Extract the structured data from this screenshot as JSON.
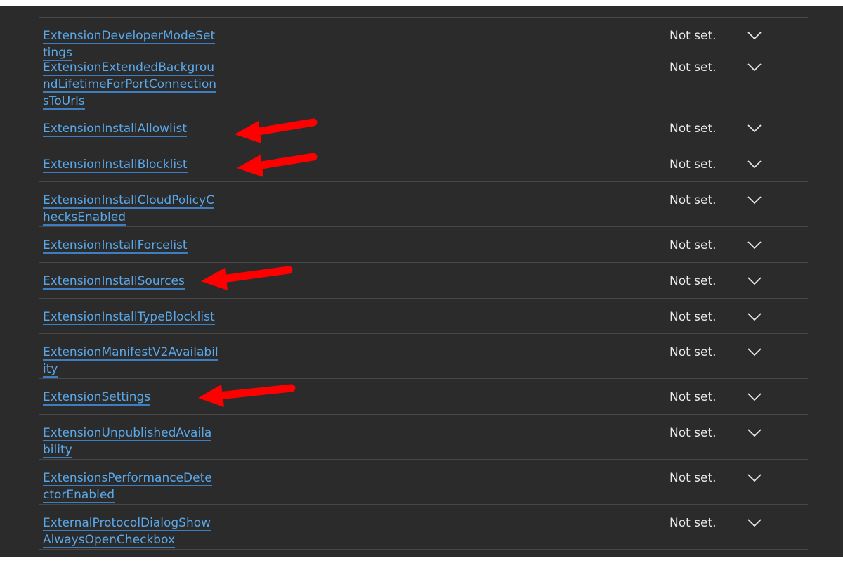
{
  "policies": [
    {
      "name": "ExtensionDeveloperModeSettings",
      "status": "Not set."
    },
    {
      "name": "ExtensionExtendedBackgroundLifetimeForPortConnectionsToUrls",
      "status": "Not set."
    },
    {
      "name": "ExtensionInstallAllowlist",
      "status": "Not set."
    },
    {
      "name": "ExtensionInstallBlocklist",
      "status": "Not set."
    },
    {
      "name": "ExtensionInstallCloudPolicyChecksEnabled",
      "status": "Not set."
    },
    {
      "name": "ExtensionInstallForcelist",
      "status": "Not set."
    },
    {
      "name": "ExtensionInstallSources",
      "status": "Not set."
    },
    {
      "name": "ExtensionInstallTypeBlocklist",
      "status": "Not set."
    },
    {
      "name": "ExtensionManifestV2Availability",
      "status": "Not set."
    },
    {
      "name": "ExtensionSettings",
      "status": "Not set."
    },
    {
      "name": "ExtensionUnpublishedAvailability",
      "status": "Not set."
    },
    {
      "name": "ExtensionsPerformanceDetectorEnabled",
      "status": "Not set."
    },
    {
      "name": "ExternalProtocolDialogShowAlwaysOpenCheckbox",
      "status": "Not set."
    }
  ],
  "icons": {
    "expand": "chevron-down-icon",
    "annotation": "red-arrow-annotation"
  },
  "colors": {
    "background": "#2b2b2b",
    "link": "#5aa8ea",
    "text": "#ececec",
    "divider": "#474747",
    "arrow": "#ff0000"
  }
}
